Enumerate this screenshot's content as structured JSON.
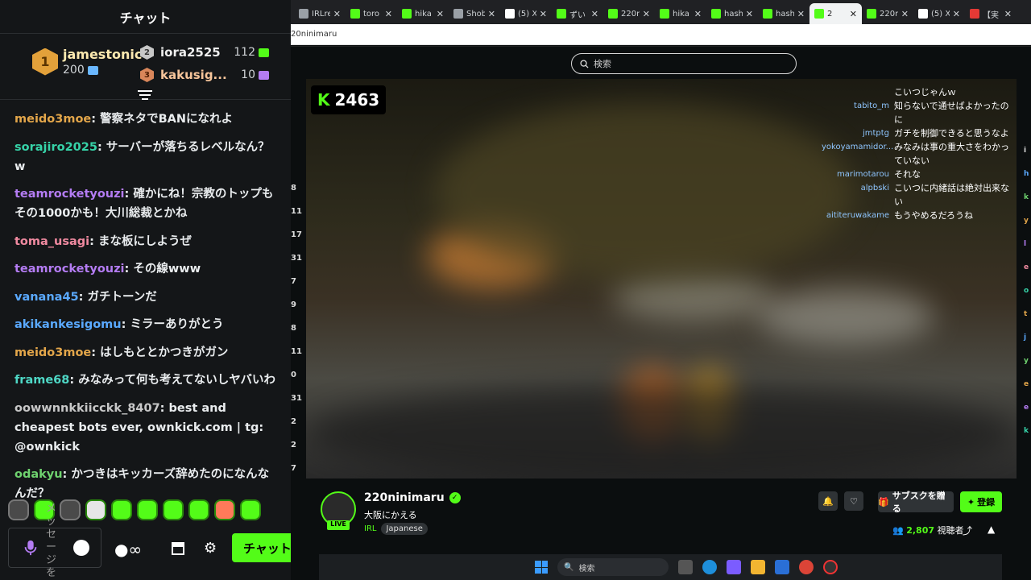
{
  "chat": {
    "header": "チャット",
    "leaderboard": {
      "first": {
        "rank": "1",
        "name": "jamestonic",
        "value": "200"
      },
      "second": {
        "rank": "2",
        "name": "iora2525",
        "value": "112"
      },
      "third": {
        "rank": "3",
        "name": "kakusig...",
        "value": "10"
      }
    },
    "messages": [
      {
        "user": "meido3moe",
        "text": "警察ネタでBANになれよ",
        "color": "#e3a64a"
      },
      {
        "user": "sorajiro2025",
        "text": "サーバーが落ちるレベルなん？w",
        "color": "#36d3a8"
      },
      {
        "user": "teamrocketyouzi",
        "text": "確かにね！宗教のトップもその1000かも！大川総裁とかね",
        "color": "#b47cf3"
      },
      {
        "user": "toma_usagi",
        "text": "まな板にしようぜ",
        "color": "#f08aa0"
      },
      {
        "user": "teamrocketyouzi",
        "text": "その線www",
        "color": "#b47cf3"
      },
      {
        "user": "vanana45",
        "text": "ガチトーンだ",
        "color": "#5aa9ff"
      },
      {
        "user": "akikankesigomu",
        "text": "ミラーありがとう",
        "color": "#5aa9ff"
      },
      {
        "user": "meido3moe",
        "text": "はしもととかつきがガン",
        "color": "#e3a64a"
      },
      {
        "user": "frame68",
        "text": "みなみって何も考えてないしヤバいわ",
        "color": "#4ed7c5"
      },
      {
        "user": "oowwnnkkiicckk_8407",
        "text": "best and cheapest bots ever, ownkick.com | tg: @ownkick",
        "color": "#c8c8c8"
      },
      {
        "user": "odakyu",
        "text": "かつきはキッカーズ辞めたのになんなんだ？",
        "color": "#6fd36f"
      }
    ],
    "input_placeholder": "メッセージを送",
    "send_label": "チャット",
    "infinity_label": "∞"
  },
  "browser": {
    "tabs": [
      {
        "title": "IRLre",
        "color": "#9aa0a6"
      },
      {
        "title": "toro",
        "color": "#53fc18"
      },
      {
        "title": "hika",
        "color": "#53fc18"
      },
      {
        "title": "Shob",
        "color": "#9aa0a6"
      },
      {
        "title": "(5) X",
        "color": "#ffffff"
      },
      {
        "title": "ずい",
        "color": "#53fc18"
      },
      {
        "title": "220n",
        "color": "#53fc18"
      },
      {
        "title": "hika",
        "color": "#53fc18"
      },
      {
        "title": "hash",
        "color": "#53fc18"
      },
      {
        "title": "hash",
        "color": "#53fc18"
      },
      {
        "title": "2",
        "color": "#53fc18",
        "active": true
      },
      {
        "title": "220n",
        "color": "#53fc18"
      },
      {
        "title": "(5) X",
        "color": "#ffffff"
      },
      {
        "title": "【実",
        "color": "#e53935"
      }
    ],
    "url": "20ninimaru",
    "search_placeholder": "検索"
  },
  "player": {
    "k_count": "2463",
    "overlay_chat": [
      {
        "user": "",
        "text": "こいつじゃんｗ"
      },
      {
        "user": "tabito_m",
        "text": "知らないで通せばよかったのに"
      },
      {
        "user": "jmtptg",
        "text": "ガチを制御できると思うなよ"
      },
      {
        "user": "yokoyamamidor...",
        "text": "みなみは事の重大さをわかっていない"
      },
      {
        "user": "marimotarou",
        "text": "それな"
      },
      {
        "user": "alpbski",
        "text": "こいつに内緒話は絶対出来ない"
      },
      {
        "user": "aititeruwakame",
        "text": "もうやめるだろうね"
      }
    ]
  },
  "channel": {
    "name": "220ninimaru",
    "live": "LIVE",
    "title": "大阪にかえる",
    "category": "IRL",
    "tag": "Japanese",
    "subscribe_label": "サブスクを贈る",
    "follow_label": "登録",
    "viewer_count": "2,807",
    "viewer_label": "視聴者"
  },
  "left_strip": [
    "8",
    "11",
    "17",
    "31",
    "7",
    "9",
    "8",
    "11",
    "0",
    "31",
    "2",
    "2",
    "7"
  ],
  "right_strip": [
    {
      "ch": "i",
      "color": "#ddd"
    },
    {
      "ch": "h",
      "color": "#5aa9ff"
    },
    {
      "ch": "k",
      "color": "#6fd36f"
    },
    {
      "ch": "y",
      "color": "#e3a64a"
    },
    {
      "ch": "l",
      "color": "#b47cf3"
    },
    {
      "ch": "e",
      "color": "#f08aa0"
    },
    {
      "ch": "o",
      "color": "#36d3a8"
    },
    {
      "ch": "t",
      "color": "#e3a64a"
    },
    {
      "ch": "j",
      "color": "#5aa9ff"
    },
    {
      "ch": "y",
      "color": "#6fd36f"
    },
    {
      "ch": "e",
      "color": "#e3a64a"
    },
    {
      "ch": "e",
      "color": "#b47cf3"
    },
    {
      "ch": "k",
      "color": "#36d3a8"
    }
  ],
  "taskbar": {
    "search_label": "検索"
  },
  "colors": {
    "brand": "#53fc18"
  }
}
